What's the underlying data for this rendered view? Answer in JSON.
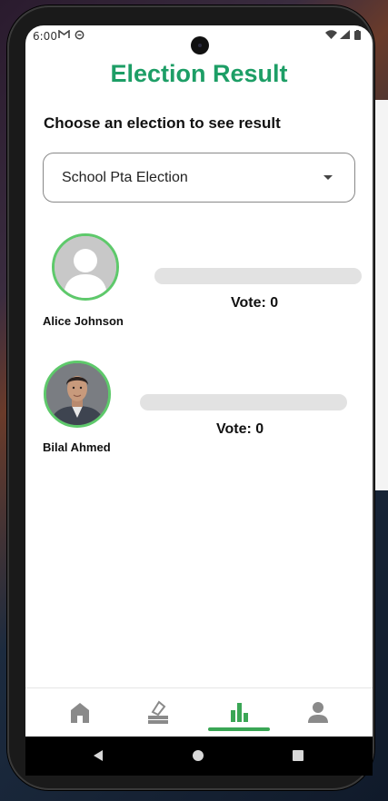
{
  "status_bar": {
    "time": "6:00",
    "icons": [
      "gmail-icon",
      "sync-icon",
      "wifi-icon",
      "signal-icon",
      "battery-icon"
    ]
  },
  "page": {
    "title": "Election Result",
    "subtitle": "Choose an election to see result"
  },
  "election_select": {
    "value": "School Pta Election"
  },
  "candidates": [
    {
      "name": "Alice Johnson",
      "vote_label": "Vote: 0",
      "votes": 0,
      "avatar": "default-user-avatar"
    },
    {
      "name": "Bilal Ahmed",
      "vote_label": "Vote: 0",
      "votes": 0,
      "avatar": "photo-avatar"
    }
  ],
  "bottom_nav": {
    "items": [
      "home-icon",
      "vote-icon",
      "results-icon",
      "profile-icon"
    ],
    "active": "results-icon"
  },
  "system_nav": [
    "back-icon",
    "home-circle-icon",
    "recents-icon"
  ],
  "colors": {
    "accent": "#1d9e66",
    "active_tab": "#3aa655",
    "avatar_border": "#5ec96b"
  }
}
